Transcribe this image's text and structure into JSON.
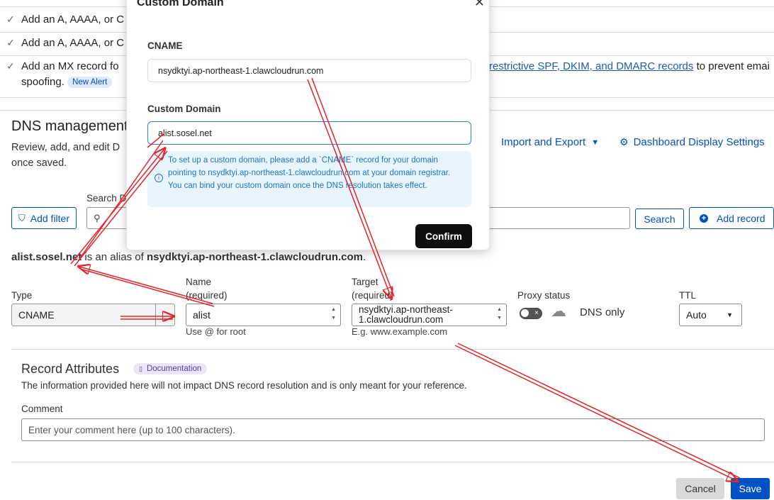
{
  "alerts": [
    {
      "text": "Add an A, AAAA, or C"
    },
    {
      "text": "Add an A, AAAA, or C"
    },
    {
      "text_before": "Add an MX record fo",
      "link": "restrictive SPF, DKIM, and DMARC records",
      "text_after": " to prevent emai",
      "line2": "spoofing.",
      "badge": "New Alert"
    }
  ],
  "dns": {
    "title": "DNS management",
    "description_line1": "Review, add, and edit D",
    "description_line2": "once saved.",
    "import_export": "Import and Export",
    "dashboard_settings": "Dashboard Display Settings",
    "search_label": "Search D",
    "add_filter": "Add filter",
    "search_button": "Search",
    "add_record": "Add record"
  },
  "alias": {
    "domain": "alist.sosel.net",
    "middle": " is an alias of ",
    "target": "nsydktyi.ap-northeast-1.clawcloudrun.com",
    "end": "."
  },
  "record_form": {
    "type_label": "Type",
    "type_value": "CNAME",
    "name_label": "Name",
    "name_required": "(required)",
    "name_value": "alist",
    "name_hint": "Use @ for root",
    "target_label": "Target",
    "target_required": "(required)",
    "target_value_line1": "nsydktyi.ap-northeast-",
    "target_value_line2": "1.clawcloudrun.com",
    "target_hint": "E.g. www.example.com",
    "proxy_label": "Proxy status",
    "proxy_value": "DNS only",
    "ttl_label": "TTL",
    "ttl_value": "Auto"
  },
  "attributes": {
    "title": "Record Attributes",
    "doc_badge": "Documentation",
    "description": "The information provided here will not impact DNS record resolution and is only meant for your reference.",
    "comment_label": "Comment",
    "comment_placeholder": "Enter your comment here (up to 100 characters)."
  },
  "actions": {
    "cancel": "Cancel",
    "save": "Save"
  },
  "modal": {
    "title": "Custom Domain",
    "cname_label": "CNAME",
    "cname_value": "nsydktyi.ap-northeast-1.clawcloudrun.com",
    "domain_label": "Custom Domain",
    "domain_value": "alist.sosel.net",
    "info": "To set up a custom domain, please add a `CNAME` record for your domain pointing to nsydktyi.ap-northeast-1.clawcloudrun.com at your domain registrar. You can bind your custom domain once the DNS resolution takes effect.",
    "confirm": "Confirm"
  },
  "colors": {
    "accent": "#0051c3",
    "annotation_arrow": "#e3262b",
    "info_text": "#1a76c8"
  }
}
